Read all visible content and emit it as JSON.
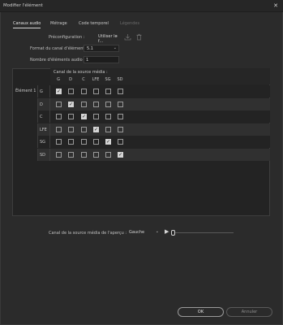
{
  "window": {
    "title": "Modifier l'élément",
    "close_glyph": "✕"
  },
  "tabs": [
    {
      "label": "Canaux audio",
      "state": "active"
    },
    {
      "label": "Métrage",
      "state": "normal"
    },
    {
      "label": "Code temporel",
      "state": "normal"
    },
    {
      "label": "Légendes",
      "state": "disabled"
    }
  ],
  "form": {
    "preset_label": "Préconfiguration :",
    "preset_value": "Utiliser le f...",
    "channel_format_label": "Format du canal d'élément :",
    "channel_format_value": "5.1",
    "audio_count_label": "Nombre d'éléments audio :",
    "audio_count_value": "1"
  },
  "icons": {
    "save_preset": "save-preset-icon",
    "delete_preset": "trash-icon"
  },
  "grid": {
    "title": "Canal de la source média :",
    "columns": [
      "G",
      "D",
      "C",
      "LFE",
      "SG",
      "SD"
    ],
    "element_label": "Élément 1",
    "rows": [
      {
        "label": "G",
        "checked": [
          true,
          false,
          false,
          false,
          false,
          false
        ]
      },
      {
        "label": "D",
        "checked": [
          false,
          true,
          false,
          false,
          false,
          false
        ]
      },
      {
        "label": "C",
        "checked": [
          false,
          false,
          true,
          false,
          false,
          false
        ]
      },
      {
        "label": "LFE",
        "checked": [
          false,
          false,
          false,
          true,
          false,
          false
        ]
      },
      {
        "label": "SG",
        "checked": [
          false,
          false,
          false,
          false,
          true,
          false
        ]
      },
      {
        "label": "SD",
        "checked": [
          false,
          false,
          false,
          false,
          false,
          true
        ]
      }
    ]
  },
  "preview": {
    "label": "Canal de la source média de l'aperçu :",
    "value": "Gauche",
    "position": 0
  },
  "buttons": {
    "ok": "OK",
    "cancel": "Annuler"
  },
  "colors": {
    "background": "#2b2b2b",
    "panel": "#232323",
    "row_alt": "#303030"
  }
}
